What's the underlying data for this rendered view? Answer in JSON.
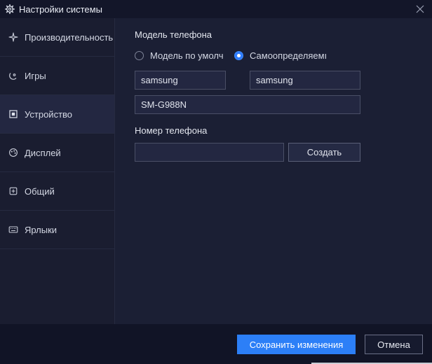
{
  "window": {
    "title": "Настройки системы",
    "icons": {
      "title": "gear-icon",
      "close": "close-icon"
    }
  },
  "sidebar": {
    "items": [
      {
        "label": "Производительность",
        "icon": "sparkle-icon",
        "active": false
      },
      {
        "label": "Игры",
        "icon": "gamepad-icon",
        "active": false
      },
      {
        "label": "Устройство",
        "icon": "device-icon",
        "active": true
      },
      {
        "label": "Дисплей",
        "icon": "display-icon",
        "active": false
      },
      {
        "label": "Общий",
        "icon": "general-icon",
        "active": false
      },
      {
        "label": "Ярлыки",
        "icon": "keyboard-icon",
        "active": false
      }
    ]
  },
  "phone_model": {
    "heading": "Модель телефона",
    "options": [
      {
        "label": "Модель по умолч",
        "checked": false
      },
      {
        "label": "Самоопределяемı",
        "checked": true
      }
    ],
    "brand_value": "samsung",
    "manufacturer_value": "samsung",
    "model_value": "SM-G988N"
  },
  "phone_number": {
    "heading": "Номер телефона",
    "value": "",
    "generate_label": "Создать"
  },
  "footer": {
    "save_label": "Сохранить изменения",
    "cancel_label": "Отмена"
  },
  "colors": {
    "accent": "#2c7ff7",
    "background": "#1b1f34",
    "sidebar_active": "#232741"
  }
}
